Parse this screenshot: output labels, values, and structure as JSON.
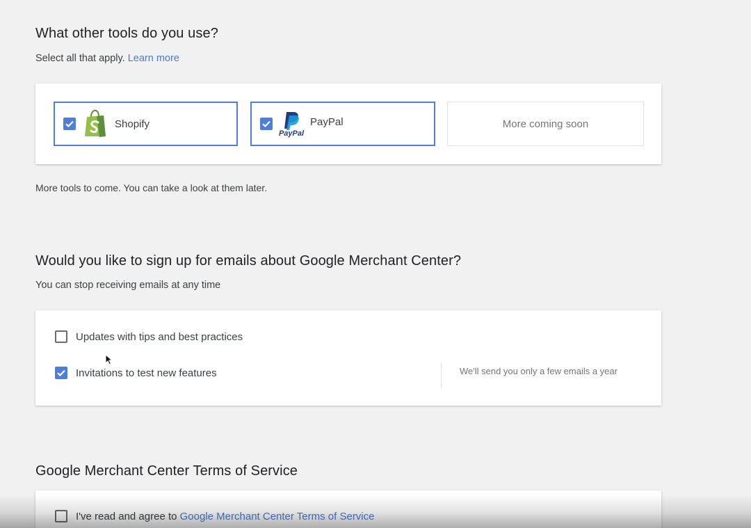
{
  "tools_section": {
    "title": "What other tools do you use?",
    "subtitle": "Select all that apply.",
    "learn_more": "Learn more",
    "tools": [
      {
        "label": "Shopify",
        "icon": "shopify-icon",
        "checked": true
      },
      {
        "label": "PayPal",
        "icon": "paypal-icon",
        "checked": true,
        "logo_text": "PayPal"
      }
    ],
    "coming_soon": "More coming soon",
    "footnote": "More tools to come. You can take a look at them later."
  },
  "emails_section": {
    "title": "Would you like to sign up for emails about Google Merchant Center?",
    "subtitle": "You can stop receiving emails at any time",
    "options": [
      {
        "label": "Updates with tips and best practices",
        "checked": false
      },
      {
        "label": "Invitations to test new features",
        "checked": true
      }
    ],
    "note": "We'll send you only a few emails a year"
  },
  "terms_section": {
    "title": "Google Merchant Center Terms of Service",
    "agree_prefix": "I've read and agree to",
    "agree_link": "Google Merchant Center Terms of Service",
    "checked": false
  },
  "colors": {
    "accent": "#4d7fd8",
    "link": "#4a7bd6",
    "shopify_green": "#95bf47",
    "paypal_navy": "#253b80",
    "paypal_blue": "#179bd7"
  }
}
